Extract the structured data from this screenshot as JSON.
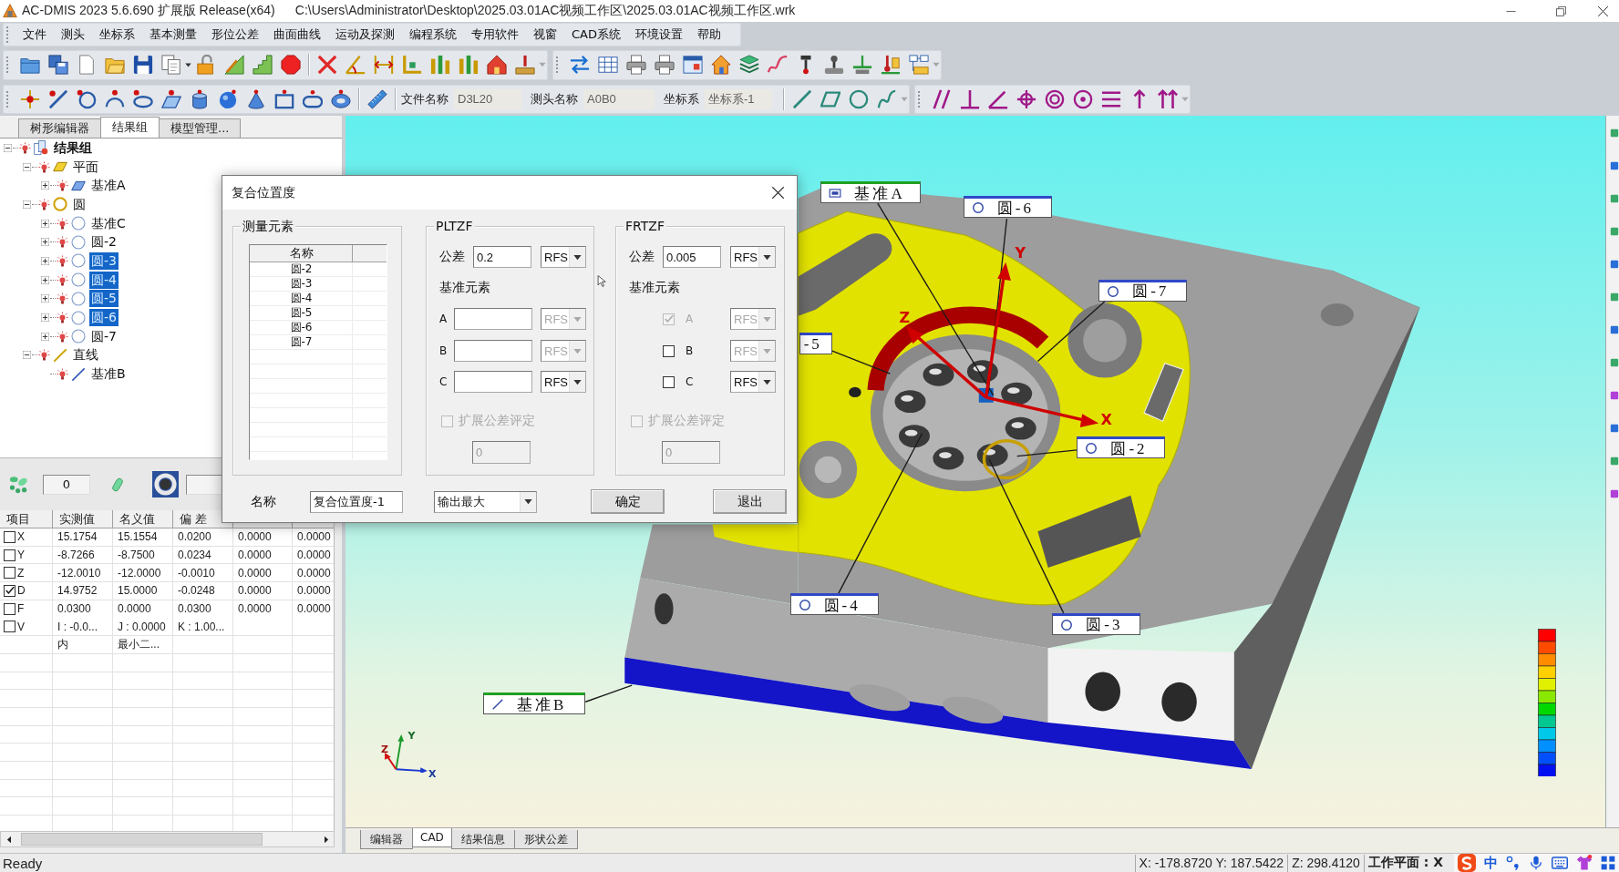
{
  "window": {
    "title": "AC-DMIS 2023 5.6.690 扩展版 Release(x64)",
    "path": "C:\\Users\\Administrator\\Desktop\\2025.03.01AC视频工作区\\2025.03.01AC视频工作区.wrk"
  },
  "menu": [
    "文件",
    "测头",
    "坐标系",
    "基本测量",
    "形位公差",
    "曲面曲线",
    "运动及探测",
    "编程系统",
    "专用软件",
    "视窗",
    "CAD系统",
    "环境设置",
    "帮助"
  ],
  "toolbar_fields": [
    {
      "label": "文件名称",
      "value": "D3L20"
    },
    {
      "label": "测头名称",
      "value": "A0B0"
    },
    {
      "label": "坐标系",
      "value": "坐标系-1"
    }
  ],
  "left_panel": {
    "tabs": [
      {
        "label": "树形编辑器",
        "selected": false
      },
      {
        "label": "结果组",
        "selected": true
      },
      {
        "label": "模型管理...",
        "selected": false
      }
    ],
    "tree": [
      {
        "label": "结果组",
        "kind": "group",
        "expanded": true,
        "selected": false,
        "children": [
          {
            "label": "平面",
            "kind": "plane",
            "expanded": true,
            "selected": false,
            "children": [
              {
                "label": "基准A",
                "kind": "plane",
                "expanded": false,
                "selected": false
              }
            ]
          },
          {
            "label": "圆",
            "kind": "circle",
            "expanded": true,
            "selected": false,
            "children": [
              {
                "label": "基准C",
                "kind": "circle",
                "expanded": false,
                "selected": false
              },
              {
                "label": "圆-2",
                "kind": "circle",
                "expanded": false,
                "selected": false
              },
              {
                "label": "圆-3",
                "kind": "circle",
                "expanded": false,
                "selected": true
              },
              {
                "label": "圆-4",
                "kind": "circle",
                "expanded": false,
                "selected": true
              },
              {
                "label": "圆-5",
                "kind": "circle",
                "expanded": false,
                "selected": true
              },
              {
                "label": "圆-6",
                "kind": "circle",
                "expanded": false,
                "selected": true
              },
              {
                "label": "圆-7",
                "kind": "circle",
                "expanded": false,
                "selected": false
              }
            ]
          },
          {
            "label": "直线",
            "kind": "line",
            "expanded": true,
            "selected": false,
            "children": [
              {
                "label": "基准B",
                "kind": "line",
                "selected": false
              }
            ]
          }
        ]
      }
    ],
    "counter": "0",
    "results": {
      "columns": [
        "项目",
        "实测值",
        "名义值",
        "偏 差"
      ],
      "rows": [
        {
          "kind": "check",
          "checked": false,
          "cells": [
            "X",
            "15.1754",
            "15.1554",
            "0.0200",
            "0.0000",
            "0.0000"
          ]
        },
        {
          "kind": "check",
          "checked": false,
          "cells": [
            "Y",
            "-8.7266",
            "-8.7500",
            "0.0234",
            "0.0000",
            "0.0000"
          ]
        },
        {
          "kind": "check",
          "checked": false,
          "cells": [
            "Z",
            "-12.0010",
            "-12.0000",
            "-0.0010",
            "0.0000",
            "0.0000"
          ]
        },
        {
          "kind": "check",
          "checked": true,
          "cells": [
            "D",
            "14.9752",
            "15.0000",
            "-0.0248",
            "0.0000",
            "0.0000"
          ]
        },
        {
          "kind": "check",
          "checked": false,
          "cells": [
            "F",
            "0.0300",
            "0.0000",
            "0.0300",
            "0.0000",
            "0.0000"
          ]
        },
        {
          "kind": "check",
          "checked": false,
          "cells": [
            "V",
            "I : -0.0...",
            "J : 0.0000",
            "K : 1.00..."
          ]
        },
        {
          "kind": "note",
          "cells": [
            "",
            "内",
            "最小二..."
          ]
        }
      ]
    }
  },
  "view": {
    "labels": [
      {
        "text": "基准A",
        "kind": "plane"
      },
      {
        "text": "圆-6",
        "kind": "circle"
      },
      {
        "text": "圆-7",
        "kind": "circle"
      },
      {
        "text": "-5",
        "kind": "partial"
      },
      {
        "text": "圆-2",
        "kind": "circle"
      },
      {
        "text": "圆-4",
        "kind": "circle"
      },
      {
        "text": "圆-3",
        "kind": "circle"
      },
      {
        "text": "基准B",
        "kind": "line"
      }
    ],
    "part_axes": [
      "Y",
      "Z",
      "X"
    ],
    "triad_axes": [
      "Y",
      "Z",
      "X"
    ],
    "tabs": [
      {
        "label": "编辑器",
        "selected": false
      },
      {
        "label": "CAD",
        "selected": true
      },
      {
        "label": "结果信息",
        "selected": false
      },
      {
        "label": "形状公差",
        "selected": false
      }
    ]
  },
  "dialog": {
    "title": "复合位置度",
    "elements": {
      "title": "测量元素",
      "column": "名称",
      "items": [
        "圆-2",
        "圆-3",
        "圆-4",
        "圆-5",
        "圆-6",
        "圆-7"
      ]
    },
    "zones": [
      {
        "title": "PLTZF",
        "tolerance_label": "公差",
        "tolerance": "0.2",
        "modifier": {
          "value": "RFS",
          "disabled": false
        },
        "datum_heading": "基准元素",
        "datums": [
          {
            "kind": "field",
            "label": "A",
            "modifier": {
              "value": "RFS",
              "disabled": true
            }
          },
          {
            "kind": "field",
            "label": "B",
            "modifier": {
              "value": "RFS",
              "disabled": true
            }
          },
          {
            "kind": "field",
            "label": "C",
            "modifier": {
              "value": "RFS",
              "disabled": false
            }
          }
        ],
        "extended": {
          "label": "扩展公差评定",
          "checked": false,
          "disabled": true
        },
        "extended_value": "0"
      },
      {
        "title": "FRTZF",
        "tolerance_label": "公差",
        "tolerance": "0.005",
        "modifier": {
          "value": "RFS",
          "disabled": false
        },
        "datum_heading": "基准元素",
        "datums": [
          {
            "kind": "checkbox",
            "label": "A",
            "checked": true,
            "disabled": true,
            "modifier": {
              "value": "RFS",
              "disabled": true
            }
          },
          {
            "kind": "checkbox",
            "label": "B",
            "checked": false,
            "disabled": false,
            "modifier": {
              "value": "RFS",
              "disabled": true
            }
          },
          {
            "kind": "checkbox",
            "label": "C",
            "checked": false,
            "disabled": false,
            "modifier": {
              "value": "RFS",
              "disabled": false
            }
          }
        ],
        "extended": {
          "label": "扩展公差评定",
          "checked": false,
          "disabled": true
        },
        "extended_value": "0"
      }
    ],
    "name_label": "名称",
    "name_value": "复合位置度-1",
    "output": "输出最大",
    "buttons": [
      "确定",
      "退出"
    ]
  },
  "status_bar": {
    "message": "Ready",
    "coordinates": [
      "X: -178.8720 Y: 187.5422",
      "Z: 298.4120"
    ],
    "work_plane": "工作平面 : X",
    "input_mode": "中"
  }
}
